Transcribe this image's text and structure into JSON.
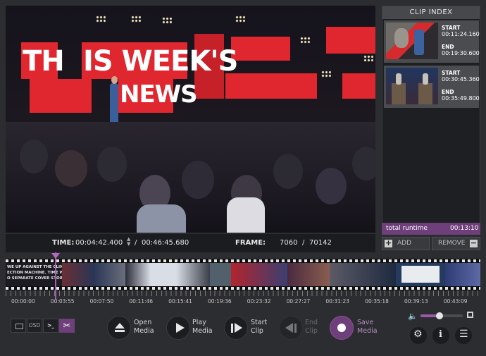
{
  "video": {
    "sign_line1": "TH",
    "sign_line1b": "IS WEEK'S",
    "sign_line2": "NEWS"
  },
  "infobar": {
    "time_label": "TIME:",
    "current_time": "00:04:42.400",
    "separator": "/",
    "total_time": "00:46:45.680",
    "frame_label": "FRAME:",
    "current_frame": "7060",
    "frame_separator": "/",
    "total_frames": "70142"
  },
  "clip_index": {
    "title": "CLIP INDEX",
    "clips": [
      {
        "start_label": "START",
        "start": "00:11:24.160",
        "end_label": "END",
        "end": "00:19:30.600"
      },
      {
        "start_label": "START",
        "start": "00:30:45.360",
        "end_label": "END",
        "end": "00:35:49.800"
      }
    ],
    "runtime_label": "total runtime",
    "runtime": "00:13:10",
    "add_label": "ADD",
    "remove_label": "REMOVE"
  },
  "timeline": {
    "thumb_text": [
      "WE UP AGAINST THE CLIMATE",
      "ECTION MACHINE. TIME WE",
      "O SEPARATE COVER STORY"
    ],
    "tick_labels": [
      "00:00:00",
      "00:03:55",
      "00:07:50",
      "00:11:46",
      "00:15:41",
      "00:19:36",
      "00:23:32",
      "00:27:27",
      "00:31:23",
      "00:35:18",
      "00:39:13",
      "00:43:09"
    ],
    "playhead_position": 0.1
  },
  "controls": {
    "mode_osd": "OSD",
    "mode_console": ">_",
    "open_label_1": "Open",
    "open_label_2": "Media",
    "play_label_1": "Play",
    "play_label_2": "Media",
    "start_label_1": "Start",
    "start_label_2": "Clip",
    "end_label_1": "End",
    "end_label_2": "Clip",
    "save_label_1": "Save",
    "save_label_2": "Media",
    "volume_level": 0.45
  },
  "colors": {
    "accent": "#a55bb3",
    "save": "#6e3f7a",
    "background": "#2b2d30"
  }
}
